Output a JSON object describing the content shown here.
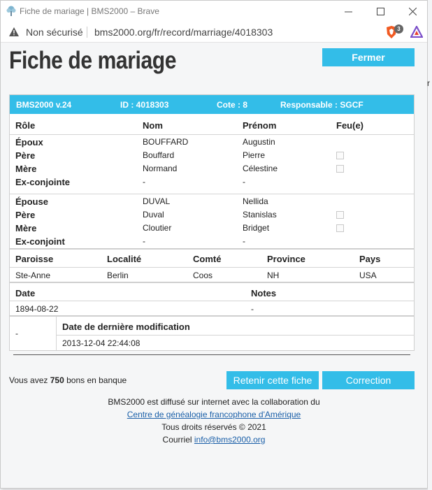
{
  "window": {
    "title": "Fiche de mariage | BMS2000 – Brave"
  },
  "address": {
    "security": "Non sécurisé",
    "url": "bms2000.org/fr/record/marriage/4018303",
    "shield_count": "3"
  },
  "page": {
    "title": "Fiche de mariage",
    "close_label": "Fermer"
  },
  "record": {
    "header": {
      "version": "BMS2000 v.24",
      "id": "ID : 4018303",
      "cote": "Cote : 8",
      "responsable": "Responsable : SGCF"
    },
    "columns": {
      "role": "Rôle",
      "nom": "Nom",
      "prenom": "Prénom",
      "feu": "Feu(e)"
    },
    "groom_group": [
      {
        "role": "Époux",
        "nom": "BOUFFARD",
        "prenom": "Augustin",
        "checkbox": false
      },
      {
        "role": "Père",
        "nom": "Bouffard",
        "prenom": "Pierre",
        "checkbox": true
      },
      {
        "role": "Mère",
        "nom": "Normand",
        "prenom": "Célestine",
        "checkbox": true
      },
      {
        "role": "Ex-conjointe",
        "nom": "-",
        "prenom": "-",
        "checkbox": false
      }
    ],
    "bride_group": [
      {
        "role": "Épouse",
        "nom": "DUVAL",
        "prenom": "Nellida",
        "checkbox": false
      },
      {
        "role": "Père",
        "nom": "Duval",
        "prenom": "Stanislas",
        "checkbox": true
      },
      {
        "role": "Mère",
        "nom": "Cloutier",
        "prenom": "Bridget",
        "checkbox": true
      },
      {
        "role": "Ex-conjoint",
        "nom": "-",
        "prenom": "-",
        "checkbox": false
      }
    ],
    "location": {
      "headers": {
        "paroisse": "Paroisse",
        "localite": "Localité",
        "comte": "Comté",
        "province": "Province",
        "pays": "Pays"
      },
      "values": {
        "paroisse": "Ste-Anne",
        "localite": "Berlin",
        "comte": "Coos",
        "province": "NH",
        "pays": "USA"
      }
    },
    "date": {
      "label": "Date",
      "value": "1894-08-22"
    },
    "notes": {
      "label": "Notes",
      "value": "-"
    },
    "modification": {
      "left_value": "-",
      "label": "Date de dernière modification",
      "value": "2013-12-04 22:44:08"
    }
  },
  "bank": {
    "prefix": "Vous avez",
    "amount": "750",
    "suffix": "bons en banque"
  },
  "actions": {
    "retain": "Retenir cette fiche",
    "correction": "Correction"
  },
  "footer": {
    "line1": "BMS2000 est diffusé sur internet avec la collaboration du",
    "link": "Centre de généalogie francophone d'Amérique",
    "rights": "Tous droits réservés © 2021",
    "courriel_label": "Courriel",
    "email": "info@bms2000.org"
  },
  "background_page": {
    "fragment": "r"
  },
  "colors": {
    "accent": "#33bde8",
    "link": "#1a5fa8"
  }
}
